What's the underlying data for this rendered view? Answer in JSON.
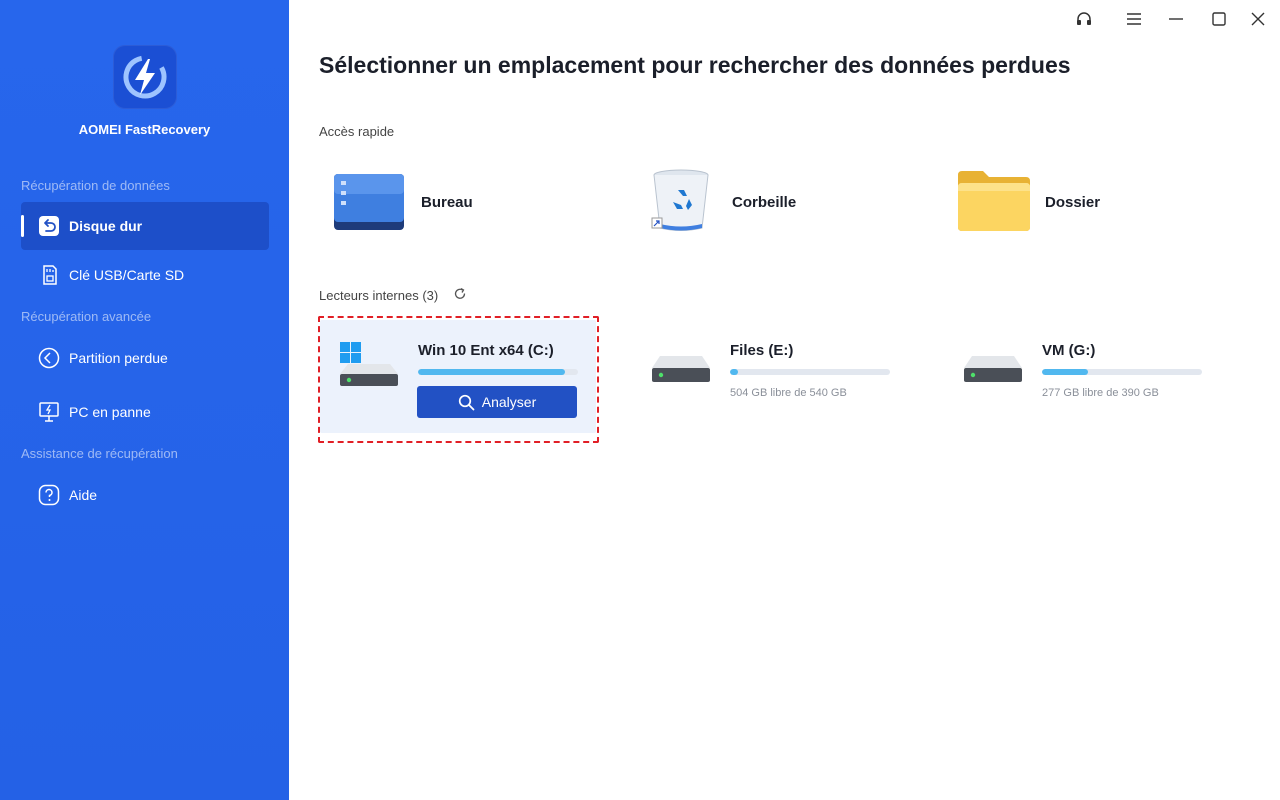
{
  "app": {
    "name": "AOMEI FastRecovery"
  },
  "sidebar": {
    "sections": [
      {
        "title": "Récupération de données"
      },
      {
        "title": "Récupération avancée"
      },
      {
        "title": "Assistance de récupération"
      }
    ],
    "items": [
      {
        "label": "Disque dur",
        "icon": "hard-disk-restore-icon",
        "active": true
      },
      {
        "label": "Clé USB/Carte SD",
        "icon": "sd-card-icon"
      },
      {
        "label": "Partition perdue",
        "icon": "partition-icon"
      },
      {
        "label": "PC en panne",
        "icon": "crashed-pc-icon"
      },
      {
        "label": "Aide",
        "icon": "help-icon"
      }
    ]
  },
  "titlebar": {
    "buttons": [
      "support-icon",
      "menu-icon",
      "minimize-icon",
      "maximize-icon",
      "close-icon"
    ]
  },
  "main": {
    "title": "Sélectionner un emplacement pour rechercher des données perdues",
    "quick_access": {
      "label": "Accès rapide",
      "items": [
        {
          "label": "Bureau",
          "icon": "desktop-icon"
        },
        {
          "label": "Corbeille",
          "icon": "recycle-bin-icon"
        },
        {
          "label": "Dossier",
          "icon": "folder-icon"
        }
      ]
    },
    "drives": {
      "label": "Lecteurs internes (3)",
      "items": [
        {
          "name": "Win 10 Ent x64 (C:)",
          "used_fraction": 0.92,
          "selected": true,
          "button": "Analyser"
        },
        {
          "name": "Files (E:)",
          "free": "504 GB libre de 540 GB",
          "used_fraction": 0.05
        },
        {
          "name": "VM (G:)",
          "free": "277 GB libre de 390 GB",
          "used_fraction": 0.29
        }
      ]
    }
  },
  "colors": {
    "sidebar": "#2563e8",
    "accent": "#2251c4",
    "progress": "#51b8ef",
    "highlight": "#e11f26"
  }
}
